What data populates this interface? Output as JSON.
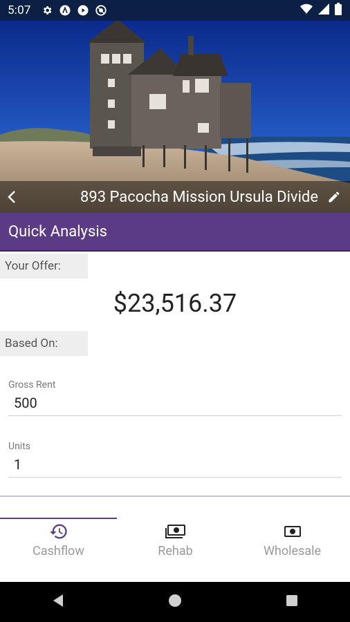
{
  "status_bar": {
    "time": "5:07"
  },
  "header": {
    "address": "893 Pacocha Mission Ursula Divide"
  },
  "section": {
    "title": "Quick Analysis"
  },
  "offer": {
    "label": "Your Offer:",
    "value": "$23,516.37"
  },
  "based_on": {
    "label": "Based On:"
  },
  "fields": [
    {
      "label": "Gross Rent",
      "value": "500"
    },
    {
      "label": "Units",
      "value": "1"
    }
  ],
  "bottom_nav": {
    "items": [
      {
        "label": "Cashflow",
        "icon": "history-icon"
      },
      {
        "label": "Rehab",
        "icon": "money-stack-icon"
      },
      {
        "label": "Wholesale",
        "icon": "money-icon"
      }
    ],
    "selected": "Cashflow"
  },
  "colors": {
    "primary": "#5b3b86",
    "status_bar": "#0c1f44"
  }
}
